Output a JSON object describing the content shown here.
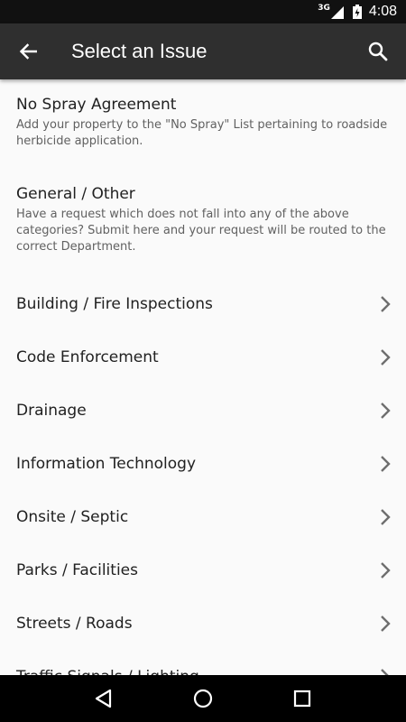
{
  "status_bar": {
    "network": "3G",
    "time": "4:08"
  },
  "app_bar": {
    "title": "Select an Issue",
    "back_icon": "arrow-back-icon",
    "search_icon": "search-icon"
  },
  "issues_with_description": [
    {
      "title": "No Spray Agreement",
      "description": "Add your property to the \"No Spray\" List pertaining to roadside herbicide application."
    },
    {
      "title": "General / Other",
      "description": "Have a request which does not fall into any of the above categories? Submit here and your request will be routed to the correct Department."
    }
  ],
  "issues": [
    "Building / Fire Inspections",
    "Code Enforcement",
    "Drainage",
    "Information Technology",
    "Onsite / Septic",
    "Parks / Facilities",
    "Streets / Roads",
    "Traffic Signals / Lighting"
  ],
  "nav_bar": {
    "back_icon": "nav-back-icon",
    "home_icon": "nav-home-icon",
    "recents_icon": "nav-recents-icon"
  }
}
